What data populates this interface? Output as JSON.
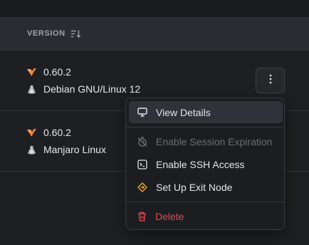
{
  "table": {
    "version_header": "VERSION",
    "sort_icon": "sort-descending-icon",
    "rows": [
      {
        "version": "0.60.2",
        "os": "Debian GNU/Linux 12",
        "app_icon": "netbird-icon",
        "os_icon": "linux-tux-icon"
      },
      {
        "version": "0.60.2",
        "os": "Manjaro Linux",
        "app_icon": "netbird-icon",
        "os_icon": "linux-tux-icon"
      }
    ]
  },
  "actions_button": {
    "icon": "kebab-vertical-icon"
  },
  "menu": {
    "items": [
      {
        "label": "View Details",
        "icon": "monitor-icon",
        "state": "highlighted"
      },
      {
        "label": "Enable Session Expiration",
        "icon": "timer-off-icon",
        "state": "disabled"
      },
      {
        "label": "Enable SSH Access",
        "icon": "terminal-square-icon",
        "state": "normal"
      },
      {
        "label": "Set Up Exit Node",
        "icon": "exit-node-diamond-icon",
        "state": "normal"
      },
      {
        "label": "Delete",
        "icon": "trash-icon",
        "state": "danger"
      }
    ]
  },
  "colors": {
    "background": "#1e1f22",
    "header_bg": "#2a2c31",
    "netbird_orange": "#f68330",
    "exit_node_yellow": "#f5a623",
    "danger_red": "#e5484d",
    "text_primary": "#e6e7ea",
    "text_disabled": "#6a6d74"
  }
}
